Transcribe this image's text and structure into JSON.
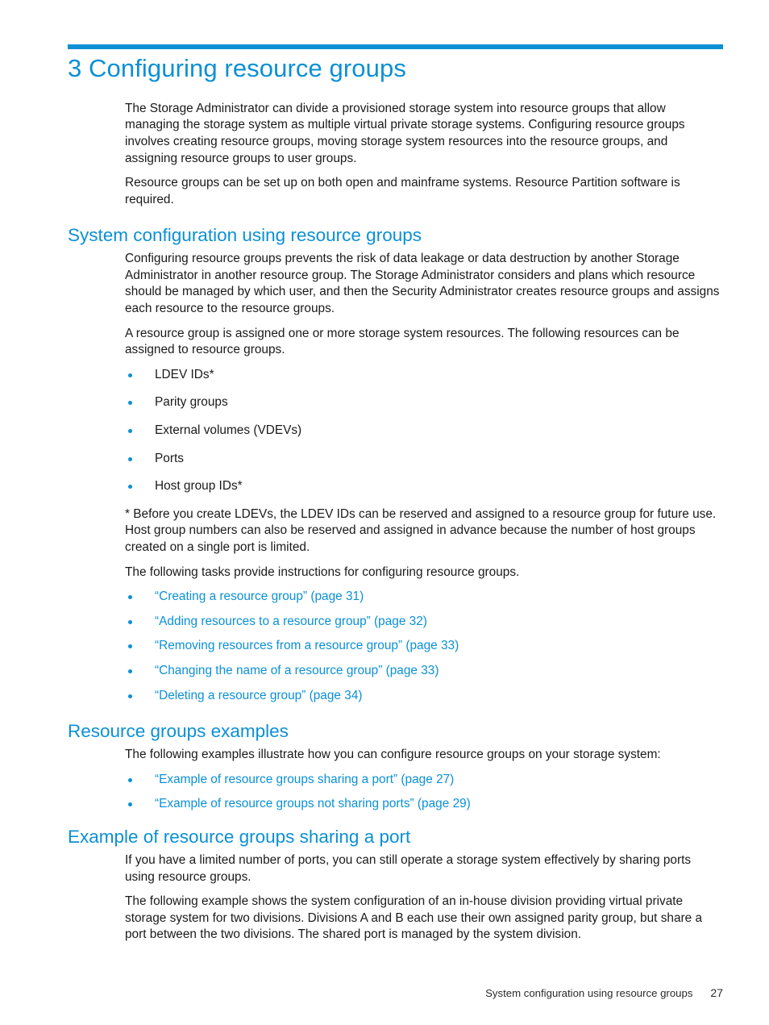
{
  "theme": {
    "accent": "#0b90d5",
    "text": "#1a1a1a"
  },
  "chapter": {
    "title": "3 Configuring resource groups",
    "intro_paragraphs": [
      "The Storage Administrator can divide a provisioned storage system into resource groups that allow managing the storage system as multiple virtual private storage systems. Configuring resource groups involves creating resource groups, moving storage system resources into the resource groups, and assigning resource groups to user groups.",
      "Resource groups can be set up on both open and mainframe systems. Resource Partition software is required."
    ]
  },
  "sections": {
    "system_configuration": {
      "heading": "System configuration using resource groups",
      "paragraphs": [
        "Configuring resource groups prevents the risk of data leakage or data destruction by another Storage Administrator in another resource group. The Storage Administrator considers and plans which resource should be managed by which user, and then the Security Administrator creates resource groups and assigns each resource to the resource groups.",
        "A resource group is assigned one or more storage system resources. The following resources can be assigned to resource groups."
      ],
      "resource_bullets": [
        "LDEV IDs*",
        "Parity groups",
        "External volumes (VDEVs)",
        "Ports",
        "Host group IDs*"
      ],
      "footnote": "* Before you create LDEVs, the LDEV IDs can be reserved and assigned to a resource group for future use. Host group numbers can also be reserved and assigned in advance because the number of host groups created on a single port is limited.",
      "tasks_intro": "The following tasks provide instructions for configuring resource groups.",
      "task_links": [
        "“Creating a resource group” (page 31)",
        "“Adding resources to a resource group” (page 32)",
        "“Removing resources from a resource group” (page 33)",
        "“Changing the name of a resource group” (page 33)",
        "“Deleting a resource group” (page 34)"
      ]
    },
    "resource_groups_examples": {
      "heading": "Resource groups examples",
      "intro": "The following examples illustrate how you can configure resource groups on your storage system:",
      "example_links": [
        "“Example of resource groups sharing a port” (page 27)",
        "“Example of resource groups not sharing ports” (page 29)"
      ]
    },
    "example_sharing_port": {
      "heading": "Example of resource groups sharing a port",
      "paragraphs": [
        "If you have a limited number of ports, you can still operate a storage system effectively by sharing ports using resource groups.",
        "The following example shows the system configuration of an in-house division providing virtual private storage system for two divisions. Divisions A and B each use their own assigned parity group, but share a port between the two divisions. The shared port is managed by the system division."
      ]
    }
  },
  "footer": {
    "running_title": "System configuration using resource groups",
    "page_number": "27"
  }
}
